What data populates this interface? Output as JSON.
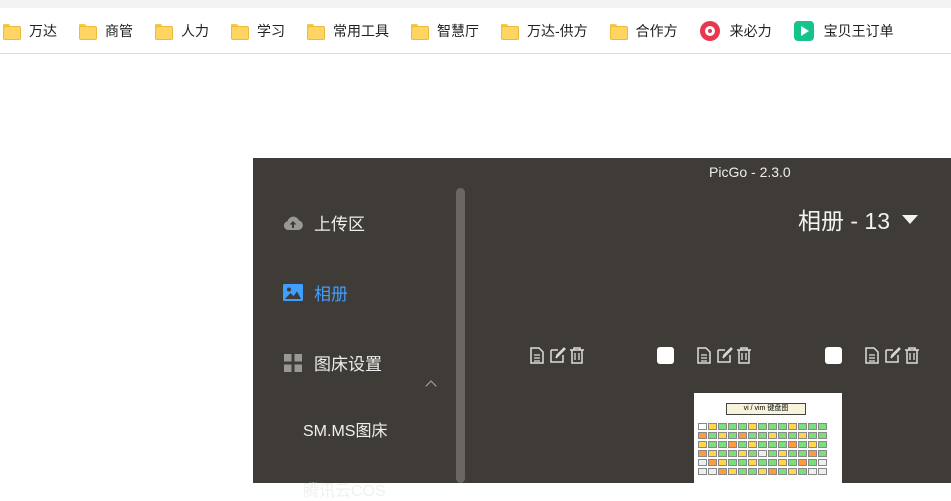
{
  "bookmarks": [
    {
      "label": "万达",
      "icon": "folder-icon"
    },
    {
      "label": "商管",
      "icon": "folder-icon"
    },
    {
      "label": "人力",
      "icon": "folder-icon"
    },
    {
      "label": "学习",
      "icon": "folder-icon"
    },
    {
      "label": "常用工具",
      "icon": "folder-icon"
    },
    {
      "label": "智慧厅",
      "icon": "folder-icon"
    },
    {
      "label": "万达-供方",
      "icon": "folder-icon"
    },
    {
      "label": "合作方",
      "icon": "folder-icon"
    },
    {
      "label": "来必力",
      "icon": "livere-icon"
    },
    {
      "label": "宝贝王订单",
      "icon": "play-icon"
    }
  ],
  "picgo": {
    "title": "PicGo - 2.3.0",
    "nav": {
      "upload": "上传区",
      "gallery": "相册",
      "settings": "图床设置",
      "smms": "SM.MS图床",
      "tencent": "腾讯云COS"
    },
    "album_title": "相册 - 13",
    "thumb_caption": "vi / vim 键盘图",
    "colors": {
      "window_bg": "#3f3c37",
      "active": "#409eff",
      "text": "#eeeeee"
    }
  }
}
